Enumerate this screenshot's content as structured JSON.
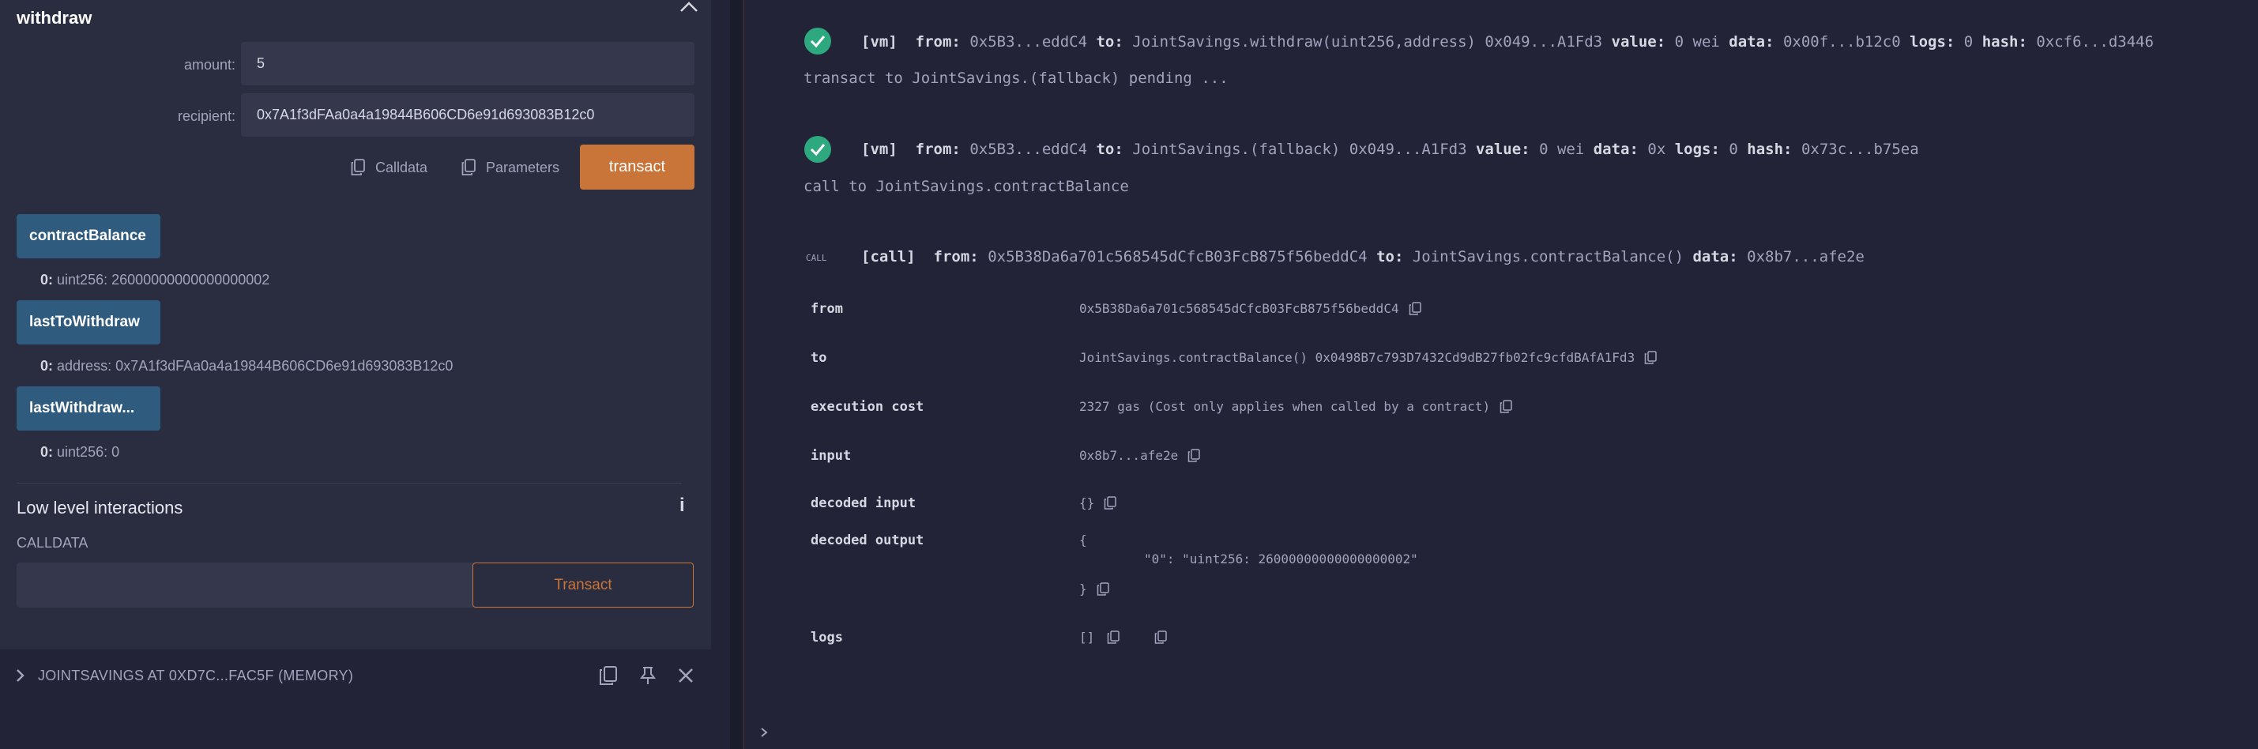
{
  "left": {
    "title": "withdraw",
    "amount_label": "amount:",
    "amount_value": "5",
    "recipient_label": "recipient:",
    "recipient_value": "0x7A1f3dFAa0a4a19844B606CD6e91d693083B12c0",
    "calldata_btn": "Calldata",
    "parameters_btn": "Parameters",
    "transact_btn": "transact",
    "functions": [
      {
        "name": "contractBalance",
        "out_index": "0:",
        "out_value": "uint256: 26000000000000000002"
      },
      {
        "name": "lastToWithdraw",
        "out_index": "0:",
        "out_value": "address: 0x7A1f3dFAa0a4a19844B606CD6e91d693083B12c0"
      },
      {
        "name": "lastWithdraw...",
        "out_index": "0:",
        "out_value": "uint256: 0"
      }
    ],
    "low_level_title": "Low level interactions",
    "calldata_label": "CALLDATA",
    "low_level_transact": "Transact",
    "instance_label": "JOINTSAVINGS AT 0XD7C...FAC5F (MEMORY)"
  },
  "terminal": {
    "line1": {
      "tag": "[vm]",
      "from_k": "from:",
      "from_v": "0x5B3...eddC4",
      "to_k": "to:",
      "to_v": "JointSavings.withdraw(uint256,address) 0x049...A1Fd3",
      "value_k": "value:",
      "value_v": "0 wei",
      "data_k": "data:",
      "data_v": "0x00f...b12c0",
      "logs_k": "logs:",
      "logs_v": "0",
      "hash_k": "hash:",
      "hash_v": "0xcf6...d3446"
    },
    "pending": "transact to JointSavings.(fallback) pending ...",
    "line2": {
      "tag": "[vm]",
      "from_k": "from:",
      "from_v": "0x5B3...eddC4",
      "to_k": "to:",
      "to_v": "JointSavings.(fallback) 0x049...A1Fd3",
      "value_k": "value:",
      "value_v": "0 wei",
      "data_k": "data:",
      "data_v": "0x",
      "logs_k": "logs:",
      "logs_v": "0",
      "hash_k": "hash:",
      "hash_v": "0x73c...b75ea"
    },
    "call_to": "call to JointSavings.contractBalance",
    "call_tag": "CALL",
    "line3": {
      "tag": "[call]",
      "from_k": "from:",
      "from_v": "0x5B38Da6a701c568545dCfcB03FcB875f56beddC4",
      "to_k": "to:",
      "to_v": "JointSavings.contractBalance()",
      "data_k": "data:",
      "data_v": "0x8b7...afe2e"
    },
    "table": {
      "from_k": "from",
      "from_v": "0x5B38Da6a701c568545dCfcB03FcB875f56beddC4",
      "to_k": "to",
      "to_v": "JointSavings.contractBalance() 0x0498B7c793D7432Cd9dB27fb02fc9cfdBAfA1Fd3",
      "cost_k": "execution cost",
      "cost_v": "2327 gas (Cost only applies when called by a contract)",
      "input_k": "input",
      "input_v": "0x8b7...afe2e",
      "dec_in_k": "decoded input",
      "dec_in_v": "{}",
      "dec_out_k": "decoded output",
      "dec_out_open": "{",
      "dec_out_body": "\"0\": \"uint256: 26000000000000000002\"",
      "dec_out_close": "}",
      "logs_k": "logs",
      "logs_v": "[]"
    }
  },
  "colors": {
    "accent": "#c97539",
    "fn_button": "#2e5b7e",
    "check": "#2ea87e"
  }
}
